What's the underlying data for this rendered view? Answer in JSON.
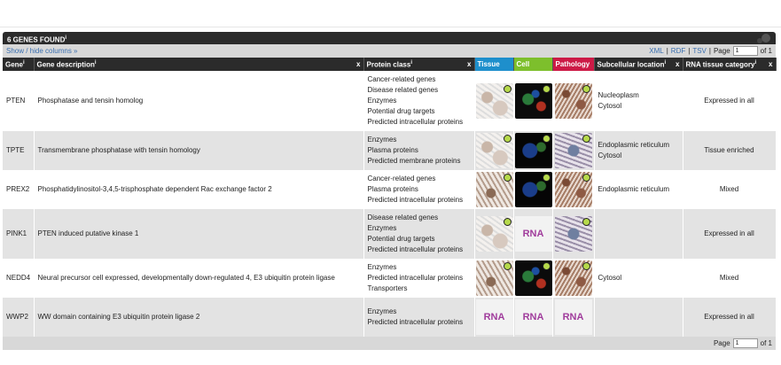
{
  "header": {
    "title": "6 GENES FOUND",
    "title_sup": "i"
  },
  "toolbar": {
    "show_hide": "Show / hide columns »",
    "xml": "XML",
    "rdf": "RDF",
    "tsv": "TSV",
    "sep": "|",
    "page_label": "Page",
    "page_value": "1",
    "of_label": "of 1"
  },
  "columns": {
    "gene": "Gene",
    "gene_sup": "i",
    "desc": "Gene description",
    "desc_sup": "i",
    "protein": "Protein class",
    "protein_sup": "i",
    "tissue": "Tissue",
    "cell": "Cell",
    "pathology": "Pathology",
    "subcell": "Subcellular location",
    "subcell_sup": "i",
    "rna": "RNA tissue category",
    "rna_sup": "i",
    "close": "x"
  },
  "rows": [
    {
      "gene": "PTEN",
      "desc": "Phosphatase and tensin homolog",
      "classes": [
        "Cancer-related genes",
        "Disease related genes",
        "Enzymes",
        "Potential drug targets",
        "Predicted intracellular proteins"
      ],
      "tissue": "image",
      "cell": "image",
      "pathology": "image",
      "subcell": [
        "Nucleoplasm",
        "Cytosol"
      ],
      "rna_cat": "Expressed in all"
    },
    {
      "gene": "TPTE",
      "desc": "Transmembrane phosphatase with tensin homology",
      "classes": [
        "Enzymes",
        "Plasma proteins",
        "Predicted membrane proteins"
      ],
      "tissue": "image",
      "cell": "image",
      "pathology": "image",
      "subcell": [
        "Endoplasmic reticulum",
        "Cytosol"
      ],
      "rna_cat": "Tissue enriched"
    },
    {
      "gene": "PREX2",
      "desc": "Phosphatidylinositol-3,4,5-trisphosphate dependent Rac exchange factor 2",
      "classes": [
        "Cancer-related genes",
        "Plasma proteins",
        "Predicted intracellular proteins"
      ],
      "tissue": "image",
      "cell": "image",
      "pathology": "image",
      "subcell": [
        "Endoplasmic reticulum"
      ],
      "rna_cat": "Mixed"
    },
    {
      "gene": "PINK1",
      "desc": "PTEN induced putative kinase 1",
      "classes": [
        "Disease related genes",
        "Enzymes",
        "Potential drug targets",
        "Predicted intracellular proteins"
      ],
      "tissue": "image",
      "cell": "RNA",
      "pathology": "image",
      "subcell": [],
      "rna_cat": "Expressed in all"
    },
    {
      "gene": "NEDD4",
      "desc": "Neural precursor cell expressed, developmentally down-regulated 4, E3 ubiquitin protein ligase",
      "classes": [
        "Enzymes",
        "Predicted intracellular proteins",
        "Transporters"
      ],
      "tissue": "image",
      "cell": "image",
      "pathology": "image",
      "subcell": [
        "Cytosol"
      ],
      "rna_cat": "Mixed"
    },
    {
      "gene": "WWP2",
      "desc": "WW domain containing E3 ubiquitin protein ligase 2",
      "classes": [
        "Enzymes",
        "Predicted intracellular proteins"
      ],
      "tissue": "RNA",
      "cell": "RNA",
      "pathology": "RNA",
      "subcell": [],
      "rna_cat": "Expressed in all"
    }
  ],
  "footer": {
    "page_label": "Page",
    "page_value": "1",
    "of_label": "of 1"
  }
}
